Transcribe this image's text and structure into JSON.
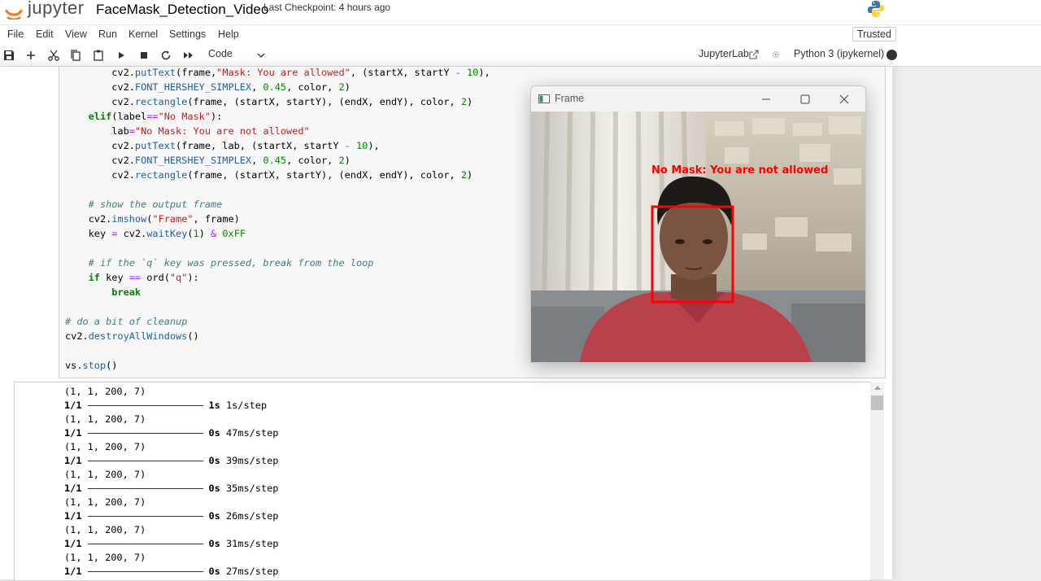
{
  "header": {
    "logo_text": "jupyter",
    "notebook_title": "FaceMask_Detection_Video",
    "checkpoint": "Last Checkpoint: 4 hours ago"
  },
  "menubar": {
    "items": [
      "File",
      "Edit",
      "View",
      "Run",
      "Kernel",
      "Settings",
      "Help"
    ],
    "trusted": "Trusted"
  },
  "toolbar": {
    "icons": [
      "save-icon",
      "add-cell-icon",
      "cut-icon",
      "copy-icon",
      "paste-icon",
      "run-icon",
      "stop-icon",
      "restart-icon",
      "fast-forward-icon"
    ],
    "cell_type": "Code",
    "jupyterlab_link": "JupyterLab",
    "kernel": "Python 3 (ipykernel)"
  },
  "code_lines": [
    "        cv2.putText(frame,\"Mask: You are allowed\", (startX, startY - 10),",
    "        cv2.FONT_HERSHEY_SIMPLEX, 0.45, color, 2)",
    "        cv2.rectangle(frame, (startX, startY), (endX, endY), color, 2)",
    "    elif(label==\"No Mask\"):",
    "        lab=\"No Mask: You are not allowed\"",
    "        cv2.putText(frame, lab, (startX, startY - 10),",
    "        cv2.FONT_HERSHEY_SIMPLEX, 0.45, color, 2)",
    "        cv2.rectangle(frame, (startX, startY), (endX, endY), color, 2)",
    "",
    "    # show the output frame",
    "    cv2.imshow(\"Frame\", frame)",
    "    key = cv2.waitKey(1) & 0xFF",
    "",
    "    # if the `q` key was pressed, break from the loop",
    "    if key == ord(\"q\"):",
    "        break",
    "",
    "# do a bit of cleanup",
    "cv2.destroyAllWindows()",
    "",
    "vs.stop()"
  ],
  "output_rows": [
    {
      "shape": "(1, 1, 200, 7)",
      "step": "1/1",
      "time": "1s",
      "rate": "1s/step"
    },
    {
      "shape": "(1, 1, 200, 7)",
      "step": "1/1",
      "time": "0s",
      "rate": "47ms/step"
    },
    {
      "shape": "(1, 1, 200, 7)",
      "step": "1/1",
      "time": "0s",
      "rate": "39ms/step"
    },
    {
      "shape": "(1, 1, 200, 7)",
      "step": "1/1",
      "time": "0s",
      "rate": "35ms/step"
    },
    {
      "shape": "(1, 1, 200, 7)",
      "step": "1/1",
      "time": "0s",
      "rate": "26ms/step"
    },
    {
      "shape": "(1, 1, 200, 7)",
      "step": "1/1",
      "time": "0s",
      "rate": "31ms/step"
    },
    {
      "shape": "(1, 1, 200, 7)",
      "step": "1/1",
      "time": "0s",
      "rate": "27ms/step"
    }
  ],
  "frame_window": {
    "title": "Frame",
    "overlay_text": "No Mask: You are not allowed",
    "box_color": "#ff0000"
  },
  "colors": {
    "jupyter_orange": "#f37726",
    "code_bg": "#f7f7f7",
    "keyword_green": "#008000",
    "string_red": "#ba2121"
  }
}
